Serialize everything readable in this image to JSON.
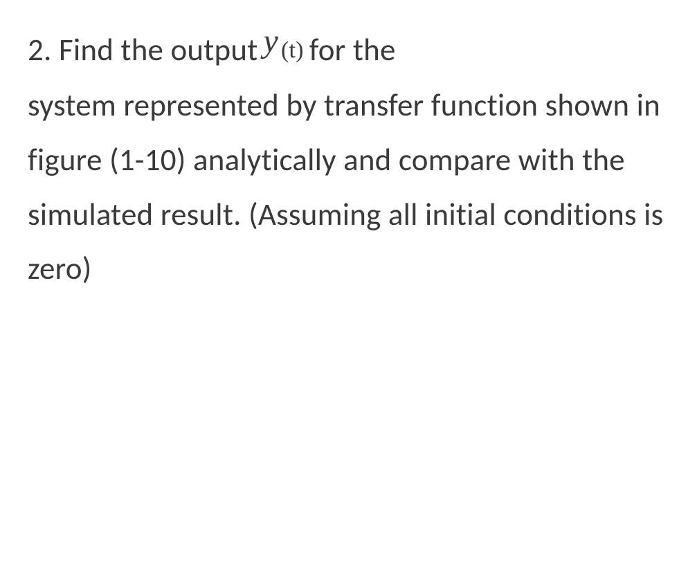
{
  "problem": {
    "number": "2.",
    "line1_prefix": "Find the output",
    "math_var": "y",
    "math_sub": "(t)",
    "line1_suffix": "for the",
    "remaining": "system represented by transfer function shown in figure (1-10) analytically and compare with the simulated  result. (Assuming all initial conditions is zero)"
  }
}
